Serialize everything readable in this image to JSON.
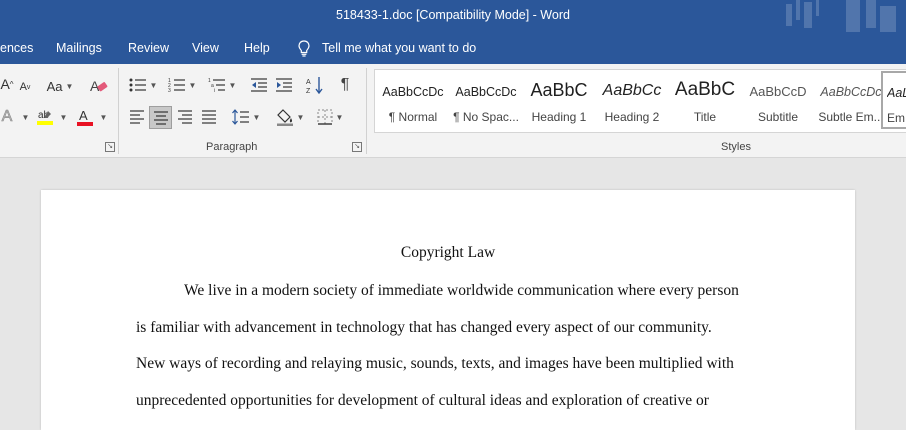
{
  "window": {
    "title": "518433-1.doc [Compatibility Mode]  -  Word"
  },
  "menu": {
    "items": [
      "ences",
      "Mailings",
      "Review",
      "View",
      "Help"
    ],
    "tell_me": "Tell me what you want to do"
  },
  "ribbon": {
    "paragraph_label": "Paragraph",
    "styles_label": "Styles",
    "font_buttons": {
      "grow": "A",
      "shrink": "A",
      "case": "Aa",
      "text_effects": "A",
      "text_color": "A"
    },
    "colors": {
      "highlight": "#ffff00",
      "font_color": "#e81123",
      "brand": "#2b579a"
    }
  },
  "styles": [
    {
      "sample": "AaBbCcDc",
      "label": "¶ Normal"
    },
    {
      "sample": "AaBbCcDc",
      "label": "¶ No Spac..."
    },
    {
      "sample": "AaBbC",
      "label": "Heading 1"
    },
    {
      "sample": "AaBbCc",
      "label": "Heading 2"
    },
    {
      "sample": "AaBbC",
      "label": "Title"
    },
    {
      "sample": "AaBbCcD",
      "label": "Subtitle"
    },
    {
      "sample": "AaBbCcDc",
      "label": "Subtle Em..."
    },
    {
      "sample": "AaL",
      "label": "Em"
    }
  ],
  "document": {
    "title": "Copyright Law",
    "lines": [
      "We live in a modern society of immediate worldwide communication where every person",
      "is familiar with advancement in technology that has changed every aspect of our community.",
      "New ways of recording and relaying music, sounds, texts, and images have been multiplied with",
      "unprecedented opportunities for development of cultural ideas and exploration of creative or"
    ]
  }
}
